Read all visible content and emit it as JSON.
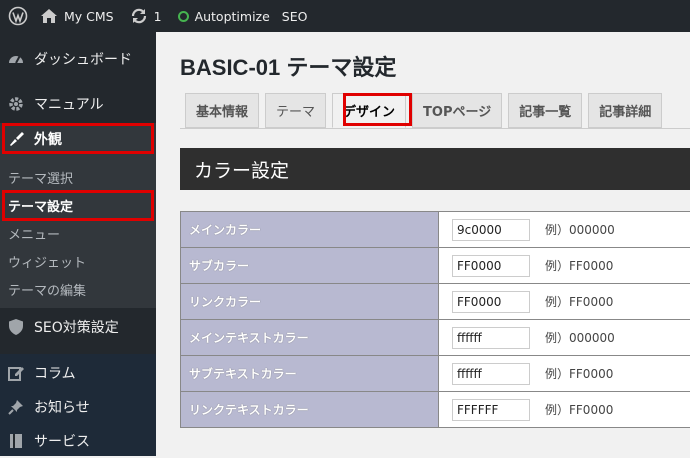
{
  "adminbar": {
    "site_name": "My CMS",
    "updates_count": "1",
    "autoptimize": "Autoptimize",
    "seo": "SEO"
  },
  "sidebar": {
    "dashboard": "ダッシュボード",
    "manual": "マニュアル",
    "appearance": "外観",
    "submenu": [
      "テーマ選択",
      "テーマ設定",
      "メニュー",
      "ウィジェット",
      "テーマの編集"
    ],
    "seo_settings": "SEO対策設定",
    "column": "コラム",
    "news": "お知らせ",
    "service": "サービス"
  },
  "main": {
    "title": "BASIC-01 テーマ設定",
    "tabs": [
      "基本情報",
      "テーマ",
      "デザイン",
      "TOPページ",
      "記事一覧",
      "記事詳細"
    ],
    "active_tab": "デザイン",
    "section_title": "カラー設定",
    "rows": [
      {
        "label": "メインカラー",
        "value": "9c0000",
        "example": "例）000000"
      },
      {
        "label": "サブカラー",
        "value": "FF0000",
        "example": "例）FF0000"
      },
      {
        "label": "リンクカラー",
        "value": "FF0000",
        "example": "例）FF0000"
      },
      {
        "label": "メインテキストカラー",
        "value": "ffffff",
        "example": "例）000000"
      },
      {
        "label": "サブテキストカラー",
        "value": "ffffff",
        "example": "例）FF0000"
      },
      {
        "label": "リンクテキストカラー",
        "value": "FFFFFF",
        "example": "例）FF0000"
      }
    ]
  },
  "colors": {
    "admin_dark": "#23282d",
    "highlight_red": "#e00000",
    "label_bg": "#b8b9d1",
    "section_head": "#2f2f2f"
  }
}
